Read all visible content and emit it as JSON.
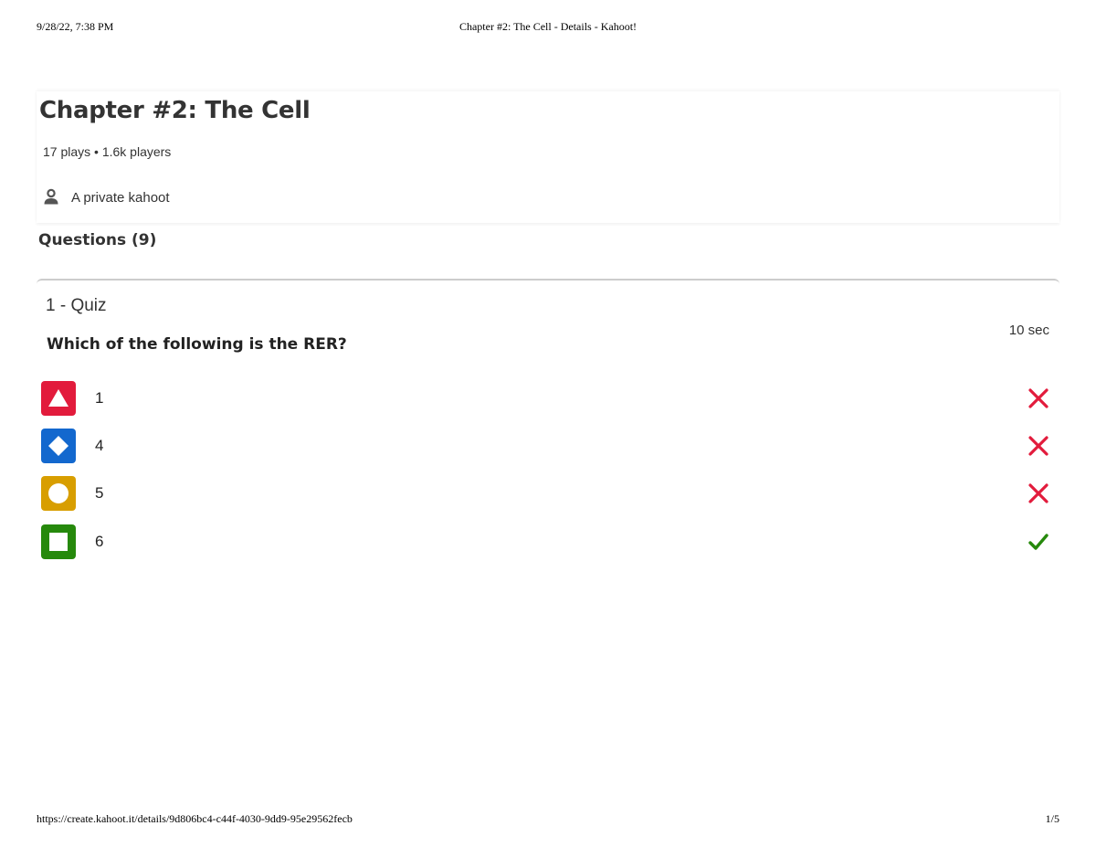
{
  "print_header": {
    "datetime": "9/28/22, 7:38 PM",
    "page_title": "Chapter #2: The Cell - Details - Kahoot!"
  },
  "kahoot": {
    "title": "Chapter #2: The Cell",
    "stats": "17 plays • 1.6k players",
    "privacy": "A private kahoot",
    "privacy_icon": "user-icon"
  },
  "questions_section": {
    "heading": "Questions (9)"
  },
  "question": {
    "type_label": "1 - Quiz",
    "time_label": "10 sec",
    "text": "Which of the following is the RER?",
    "answers": [
      {
        "text": "1",
        "shape": "triangle-icon",
        "color": "#e21b3c",
        "correct": false
      },
      {
        "text": "4",
        "shape": "diamond-icon",
        "color": "#1368ce",
        "correct": false
      },
      {
        "text": "5",
        "shape": "circle-icon",
        "color": "#d89e00",
        "correct": false
      },
      {
        "text": "6",
        "shape": "square-icon",
        "color": "#26890c",
        "correct": true
      }
    ],
    "incorrect_color": "#e21b3c",
    "correct_color": "#26890c"
  },
  "print_footer": {
    "url": "https://create.kahoot.it/details/9d806bc4-c44f-4030-9dd9-95e29562fecb",
    "page_number": "1/5"
  }
}
